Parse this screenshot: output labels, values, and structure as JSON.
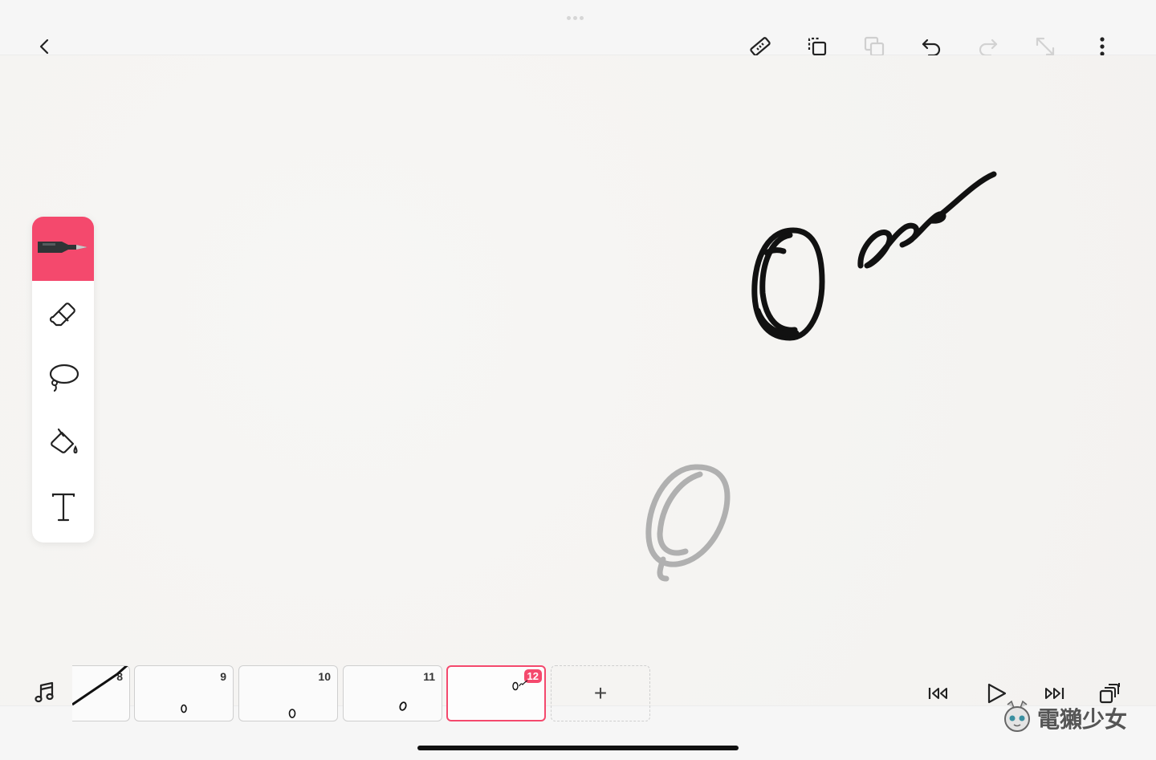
{
  "colors": {
    "accent": "#f4496d",
    "ink": "#111111",
    "onion": "#a9a9a9"
  },
  "top_bar": {
    "icons": [
      "chevron-left-icon",
      "ruler-icon",
      "copy-frame-icon",
      "paste-icon",
      "undo-icon",
      "redo-icon",
      "resize-icon",
      "more-vertical-icon"
    ]
  },
  "tools": [
    "pen-tool",
    "eraser-tool",
    "lasso-tool",
    "fill-bucket-tool",
    "text-tool"
  ],
  "timeline": {
    "frames": [
      {
        "number": "8"
      },
      {
        "number": "9"
      },
      {
        "number": "10"
      },
      {
        "number": "11"
      },
      {
        "number": "12",
        "current": true
      }
    ],
    "add_label": "+"
  },
  "playback": {
    "icons": [
      "music-note-icon",
      "skip-to-start-icon",
      "play-icon",
      "skip-to-end-icon",
      "onion-skin-icon"
    ]
  },
  "watermark": {
    "text": "電獺少女"
  }
}
